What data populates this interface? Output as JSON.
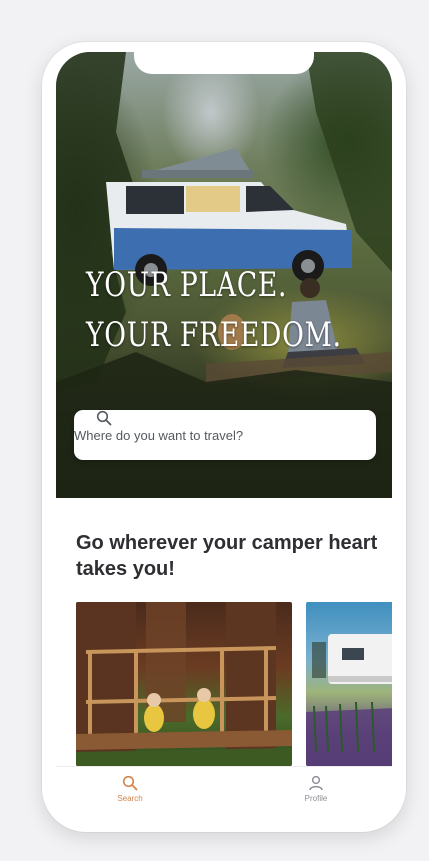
{
  "hero": {
    "title_line1": "Your place.",
    "title_line2": "Your freedom."
  },
  "search": {
    "placeholder": "Where do you want to travel?",
    "icon": "search-icon"
  },
  "section": {
    "heading": "Go wherever your camper heart takes you!"
  },
  "tabbar": {
    "items": [
      {
        "label": "Search",
        "icon": "search-icon",
        "active": true
      },
      {
        "label": "Profile",
        "icon": "profile-icon",
        "active": false
      }
    ]
  },
  "colors": {
    "accent": "#d5834b",
    "heading_text": "#2e2e33",
    "inactive_tab": "#8a8d93",
    "van_blue": "#3d6fb0"
  }
}
